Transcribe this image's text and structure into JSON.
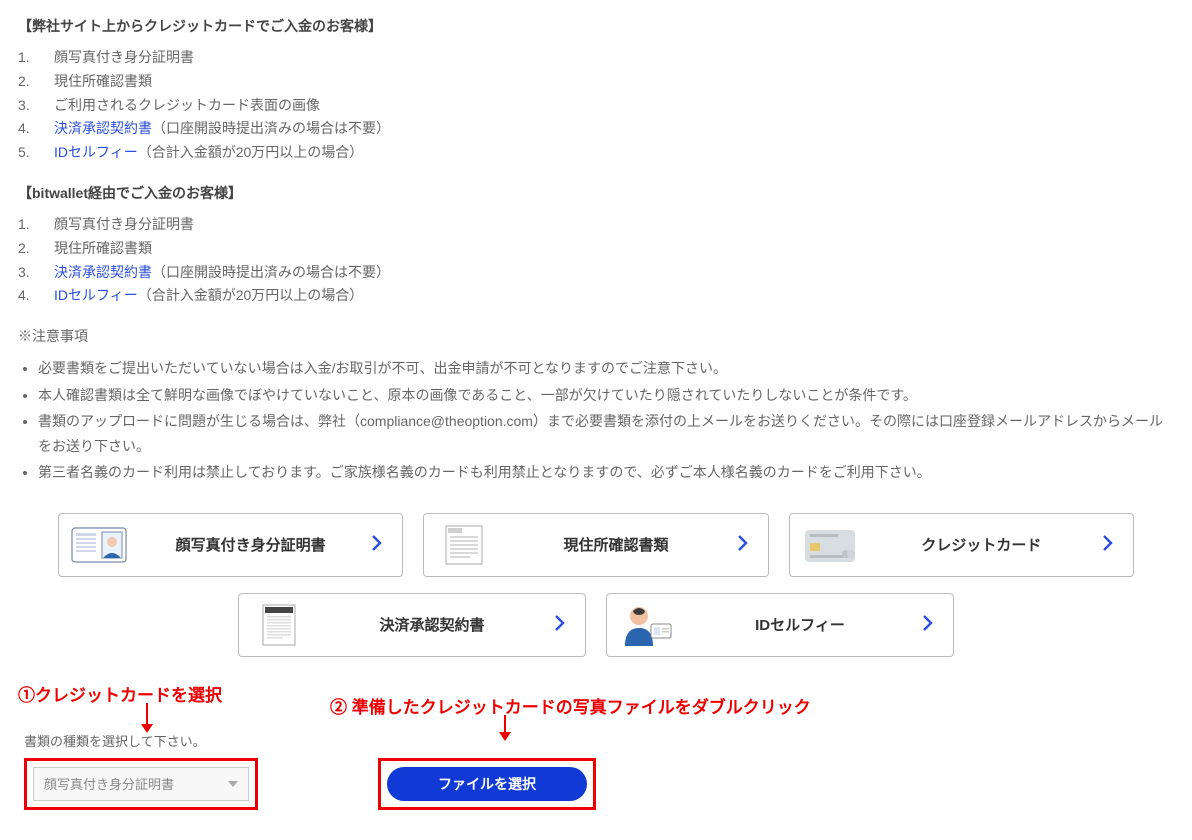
{
  "section_a": {
    "heading": "【弊社サイト上からクレジットカードでご入金のお客様】",
    "items": [
      {
        "n": "1.",
        "text": "顔写真付き身分証明書"
      },
      {
        "n": "2.",
        "text": "現住所確認書類"
      },
      {
        "n": "3.",
        "text": "ご利用されるクレジットカード表面の画像"
      },
      {
        "n": "4.",
        "link": "決済承認契約書",
        "suffix": "（口座開設時提出済みの場合は不要）"
      },
      {
        "n": "5.",
        "link": "IDセルフィー",
        "suffix": "（合計入金額が20万円以上の場合）"
      }
    ]
  },
  "section_b": {
    "heading": "【bitwallet経由でご入金のお客様】",
    "items": [
      {
        "n": "1.",
        "text": "顔写真付き身分証明書"
      },
      {
        "n": "2.",
        "text": "現住所確認書類"
      },
      {
        "n": "3.",
        "link": "決済承認契約書",
        "suffix": "（口座開設時提出済みの場合は不要）"
      },
      {
        "n": "4.",
        "link": "IDセルフィー",
        "suffix": "（合計入金額が20万円以上の場合）"
      }
    ]
  },
  "notes": {
    "heading": "※注意事項",
    "bullets": [
      "必要書類をご提出いただいていない場合は入金/お取引が不可、出金申請が不可となりますのでご注意下さい。",
      "本人確認書類は全て鮮明な画像でぼやけていないこと、原本の画像であること、一部が欠けていたり隠されていたりしないことが条件です。",
      "書類のアップロードに問題が生じる場合は、弊社（compliance@theoption.com）まで必要書類を添付の上メールをお送りください。その際には口座登録メールアドレスからメールをお送り下さい。",
      "第三者名義のカード利用は禁止しております。ご家族様名義のカードも利用禁止となりますので、必ずご本人様名義のカードをご利用下さい。"
    ]
  },
  "cards": {
    "row1": [
      {
        "label": "顔写真付き身分証明書",
        "icon": "id-card"
      },
      {
        "label": "現住所確認書類",
        "icon": "address-doc"
      },
      {
        "label": "クレジットカード",
        "icon": "credit-card"
      }
    ],
    "row2": [
      {
        "label": "決済承認契約書",
        "icon": "contract-doc"
      },
      {
        "label": "IDセルフィー",
        "icon": "selfie"
      }
    ]
  },
  "annotations": {
    "a1": "①クレジットカードを選択",
    "a2": "② 準備したクレジットカードの写真ファイルをダブルクリック"
  },
  "form": {
    "select_label": "書類の種類を選択して下さい。",
    "select_value": "顔写真付き身分証明書",
    "file_button": "ファイルを選択"
  }
}
